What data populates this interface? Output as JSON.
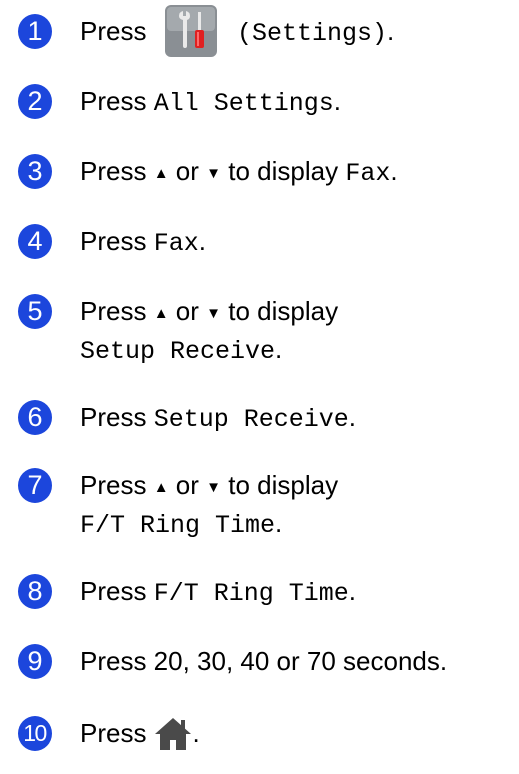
{
  "steps": [
    {
      "number": "1",
      "press": "Press",
      "icon": "settings-icon",
      "mono": "(Settings)",
      "end": "."
    },
    {
      "number": "2",
      "press": "Press",
      "mono": "All Settings",
      "end": "."
    },
    {
      "number": "3",
      "prefix": "Press",
      "up": "▲",
      "or": "or",
      "down": "▼",
      "middle": "to display",
      "mono": "Fax",
      "end": "."
    },
    {
      "number": "4",
      "press": "Press",
      "mono": "Fax",
      "end": "."
    },
    {
      "number": "5",
      "prefix": "Press",
      "up": "▲",
      "or": "or",
      "down": "▼",
      "middle": "to display",
      "mono": "Setup Receive",
      "end": "."
    },
    {
      "number": "6",
      "press": "Press",
      "mono": "Setup Receive",
      "end": "."
    },
    {
      "number": "7",
      "prefix": "Press",
      "up": "▲",
      "or": "or",
      "down": "▼",
      "middle": "to display",
      "mono": "F/T Ring Time",
      "end": "."
    },
    {
      "number": "8",
      "press": "Press",
      "mono": "F/T Ring Time",
      "end": "."
    },
    {
      "number": "9",
      "text": "Press 20, 30, 40 or 70 seconds."
    },
    {
      "number": "10",
      "press": "Press",
      "icon": "home-icon",
      "end": "."
    }
  ],
  "colors": {
    "step_badge": "#1c46dc",
    "home_icon": "#4a4a4a",
    "settings_bg": "#8a8f94"
  }
}
